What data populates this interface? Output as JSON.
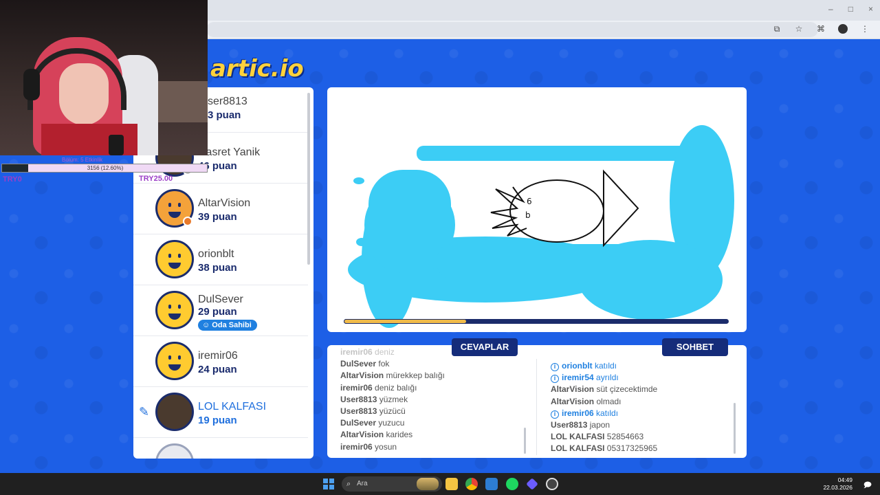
{
  "browser": {
    "window_controls": [
      "–",
      "□",
      "×"
    ],
    "toolbar_icons": [
      "cast-icon",
      "star-icon",
      "extensions-icon",
      "profile-avatar",
      "menu-icon"
    ]
  },
  "site": {
    "logo_text": "artic.io"
  },
  "players": [
    {
      "name": "User8813",
      "score": "3 puan",
      "display_name": "ser8813"
    },
    {
      "name": "Hasret Yanik",
      "score": "46 puan"
    },
    {
      "name": "AltarVision",
      "score": "39 puan"
    },
    {
      "name": "orionblt",
      "score": "38 puan"
    },
    {
      "name": "DulSever",
      "score": "29 puan",
      "badge": "Oda Sahibi"
    },
    {
      "name": "iremir06",
      "score": "24 puan"
    },
    {
      "name": "LOL KALFASI",
      "score": "19 puan",
      "drawing": true
    }
  ],
  "canvas": {
    "timer_progress": 0.32,
    "drawing_digits": [
      "6",
      "b"
    ]
  },
  "tabs": {
    "answers": "CEVAPLAR",
    "chat": "SOHBET"
  },
  "answers": [
    {
      "user": "iremir06",
      "text": "deniz"
    },
    {
      "user": "DulSever",
      "text": "fok"
    },
    {
      "user": "AltarVision",
      "text": "mürekkep balığı"
    },
    {
      "user": "iremir06",
      "text": "deniz balığı"
    },
    {
      "user": "User8813",
      "text": "yüzmek"
    },
    {
      "user": "User8813",
      "text": "yüzücü"
    },
    {
      "user": "DulSever",
      "text": "yuzucu"
    },
    {
      "user": "AltarVision",
      "text": "karides"
    },
    {
      "user": "iremir06",
      "text": "yosun"
    }
  ],
  "chat": [
    {
      "user": "orionblt",
      "text": "katıldı",
      "system": true
    },
    {
      "user": "iremir54",
      "text": "ayrıldı",
      "system": true
    },
    {
      "user": "AltarVision",
      "text": "süt çizecektimde"
    },
    {
      "user": "AltarVision",
      "text": "olmadı"
    },
    {
      "user": "iremir06",
      "text": "katıldı",
      "system": true
    },
    {
      "user": "User8813",
      "text": "japon"
    },
    {
      "user": "LOL KALFASI",
      "text": "52854663"
    },
    {
      "user": "LOL KALFASI",
      "text": "05317325965"
    }
  ],
  "overlay": {
    "xp_title": "Bölüm: 5 Etkinlik",
    "xp_text": "3156 (12.60%)",
    "xp_fraction": 0.126,
    "try_left": "TRY0",
    "try_right": "TRY25.00"
  },
  "taskbar": {
    "search_placeholder": "Ara",
    "time": "04:49",
    "date": "22.03.2026"
  },
  "colors": {
    "page_bg": "#1d5fe6",
    "navy": "#152c7a",
    "accent_blue": "#1f80e0",
    "paint_cyan": "#3ccdf5",
    "timer_yellow": "#f0bb4a"
  }
}
